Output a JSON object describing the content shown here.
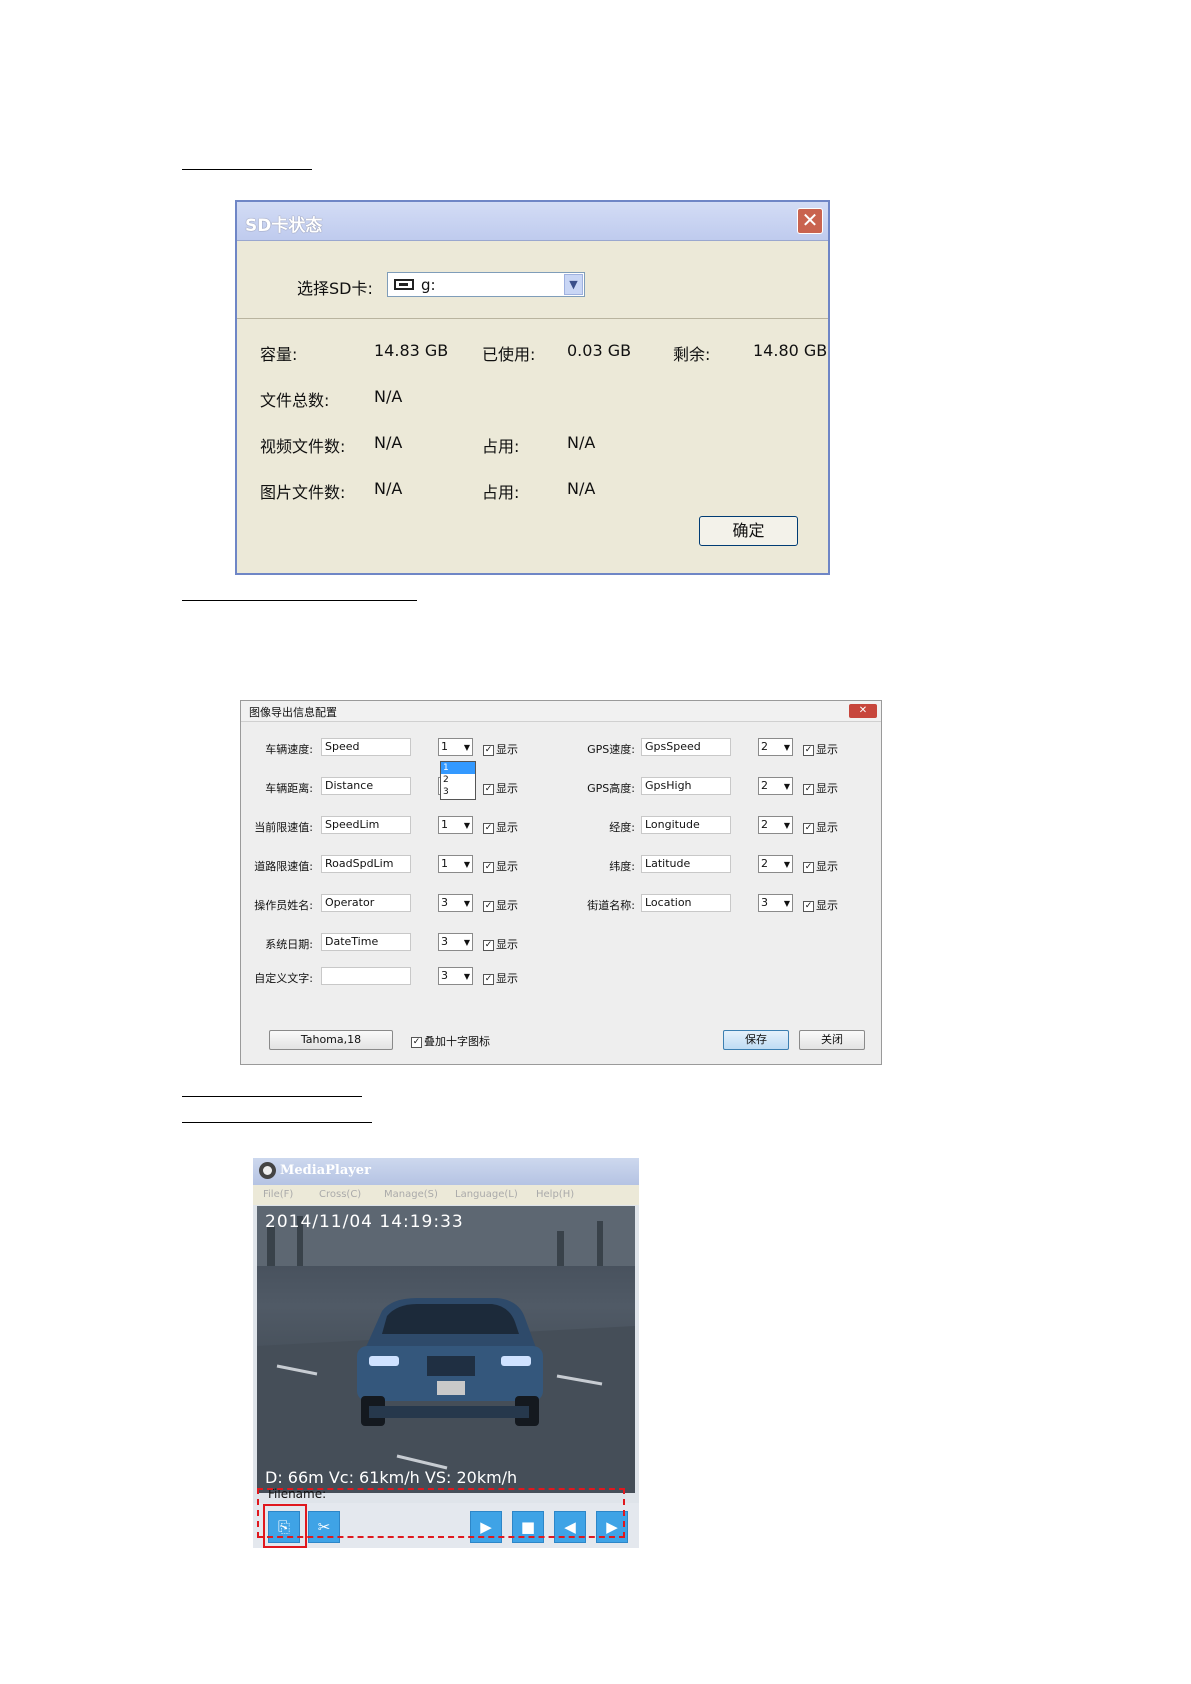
{
  "sd_dialog": {
    "title": "SD卡状态",
    "close_glyph": "✕",
    "select_label": "选择SD卡:",
    "select_value": "g:",
    "capacity_label": "容量:",
    "capacity_value": "14.83 GB",
    "used_label": "已使用:",
    "used_value": "0.03 GB",
    "remaining_label": "剩余:",
    "remaining_value": "14.80 GB",
    "total_files_label": "文件总数:",
    "total_files_value": "N/A",
    "video_files_label": "视频文件数:",
    "video_files_value": "N/A",
    "video_occupy_label": "占用:",
    "video_occupy_value": "N/A",
    "image_files_label": "图片文件数:",
    "image_files_value": "N/A",
    "image_occupy_label": "占用:",
    "image_occupy_value": "N/A",
    "ok_label": "确定"
  },
  "export_dialog": {
    "title": "图像导出信息配置",
    "close_glyph": "✕",
    "show_label": "显示",
    "left_rows": [
      {
        "label": "车辆速度:",
        "field": "Speed",
        "line": "1"
      },
      {
        "label": "车辆距离:",
        "field": "Distance",
        "line": "1"
      },
      {
        "label": "当前限速值:",
        "field": "SpeedLim",
        "line": "1"
      },
      {
        "label": "道路限速值:",
        "field": "RoadSpdLim",
        "line": "1"
      },
      {
        "label": "操作员姓名:",
        "field": "Operator",
        "line": "3"
      },
      {
        "label": "系统日期:",
        "field": "DateTime",
        "line": "3"
      },
      {
        "label": "自定义文字:",
        "field": "",
        "line": "3"
      }
    ],
    "right_rows": [
      {
        "label": "GPS速度:",
        "field": "GpsSpeed",
        "line": "2"
      },
      {
        "label": "GPS高度:",
        "field": "GpsHigh",
        "line": "2"
      },
      {
        "label": "经度:",
        "field": "Longitude",
        "line": "2"
      },
      {
        "label": "纬度:",
        "field": "Latitude",
        "line": "2"
      },
      {
        "label": "街道名称:",
        "field": "Location",
        "line": "3"
      }
    ],
    "dropdown_options": [
      "1",
      "2",
      "3"
    ],
    "font_button": "Tahoma,18",
    "crosshair_label": "叠加十字图标",
    "save_label": "保存",
    "close_label": "关闭"
  },
  "media_player": {
    "title": "MediaPlayer",
    "menu": [
      "File(F)",
      "Cross(C)",
      "Manage(S)",
      "Language(L)",
      "Help(H)"
    ],
    "timestamp": "2014/11/04 14:19:33",
    "osd": "D: 66m Vc: 61km/h VS: 20km/h",
    "filename_label": "Filename:",
    "buttons": [
      {
        "icon": "export-image-icon",
        "glyph": "⎘"
      },
      {
        "icon": "scissors-icon",
        "glyph": "✂"
      },
      {
        "icon": "play-icon",
        "glyph": "▶"
      },
      {
        "icon": "stop-icon",
        "glyph": "■"
      },
      {
        "icon": "step-back-icon",
        "glyph": "◀"
      },
      {
        "icon": "step-forward-icon",
        "glyph": "▶"
      }
    ],
    "highlight_color": "#e0181e"
  }
}
